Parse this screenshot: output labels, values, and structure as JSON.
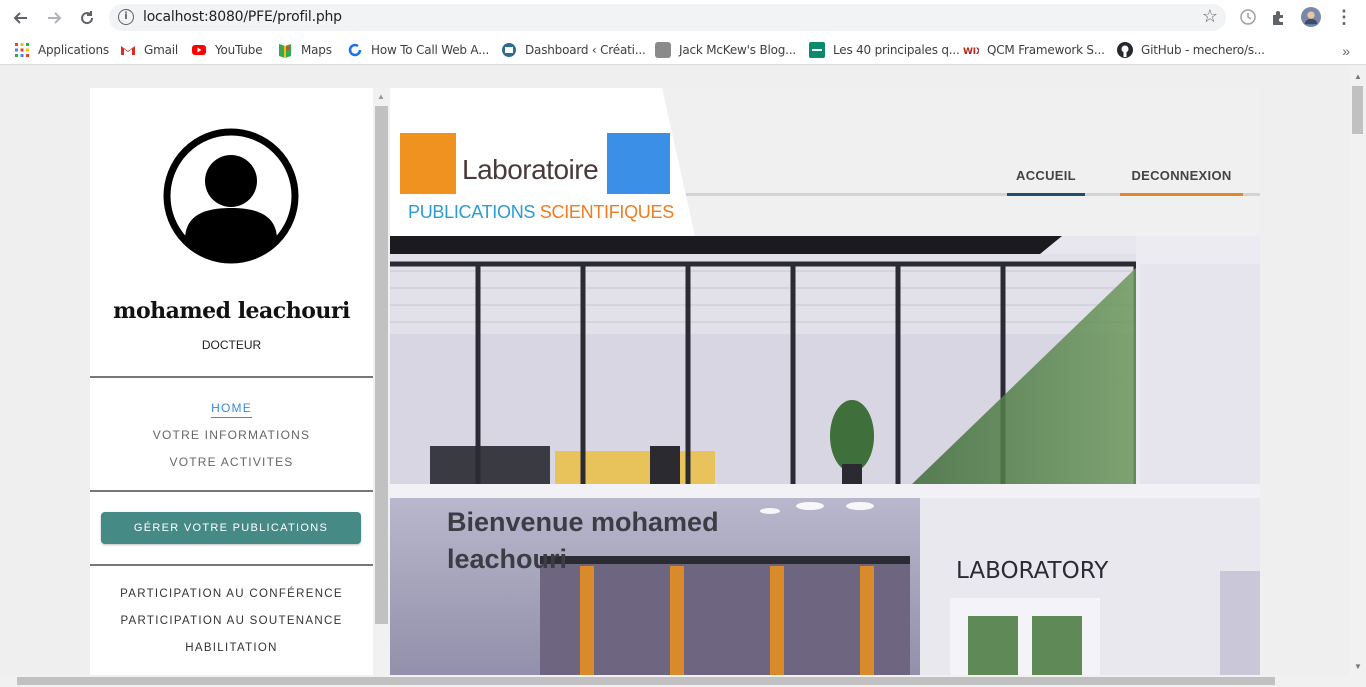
{
  "browser": {
    "url": "localhost:8080/PFE/profil.php",
    "bookmarks": [
      {
        "label": "Applications",
        "icon": "apps-grid-icon",
        "color": "#e8453c"
      },
      {
        "label": "Gmail",
        "icon": "gmail-icon",
        "color": "#d93025"
      },
      {
        "label": "YouTube",
        "icon": "youtube-icon",
        "color": "#ff0000"
      },
      {
        "label": "Maps",
        "icon": "maps-icon",
        "color": "#34a853"
      },
      {
        "label": "How To Call Web A...",
        "icon": "refresh-circle-icon",
        "color": "#1a73e8"
      },
      {
        "label": "Dashboard ‹ Créati...",
        "icon": "dashboard-icon",
        "color": "#2c6e8f"
      },
      {
        "label": "Jack McKew's Blog...",
        "icon": "page-icon",
        "color": "#8a8a8a"
      },
      {
        "label": "Les 40 principales q...",
        "icon": "list-icon",
        "color": "#0c8a6e"
      },
      {
        "label": "QCM Framework S...",
        "icon": "wix-icon",
        "color": "#b3261e"
      },
      {
        "label": "GitHub - mechero/s...",
        "icon": "github-icon",
        "color": "#24292e"
      }
    ]
  },
  "sidebar": {
    "name": "mohamed leachouri",
    "role": "DOCTEUR",
    "links": [
      "HOME",
      "VOTRE INFORMATIONS",
      "VOTRE ACTIVITES"
    ],
    "publications_button": "GÉRER VOTRE PUBLICATIONS",
    "activities": [
      "PARTICIPATION AU CONFÉRENCE",
      "PARTICIPATION AU SOUTENANCE",
      "HABILITATION"
    ]
  },
  "header": {
    "logo_title": "Laboratoire",
    "logo_sub_1": "PUBLICATIONS",
    "logo_sub_2": "SCIENTIFIQUES",
    "nav": [
      {
        "label": "ACCUEIL",
        "color": "#1f4f6a"
      },
      {
        "label": "DECONNEXION",
        "color": "#e0892a"
      }
    ]
  },
  "hero": {
    "welcome": "Bienvenue mohamed leachouri",
    "building_sign": "LABORATORY"
  }
}
